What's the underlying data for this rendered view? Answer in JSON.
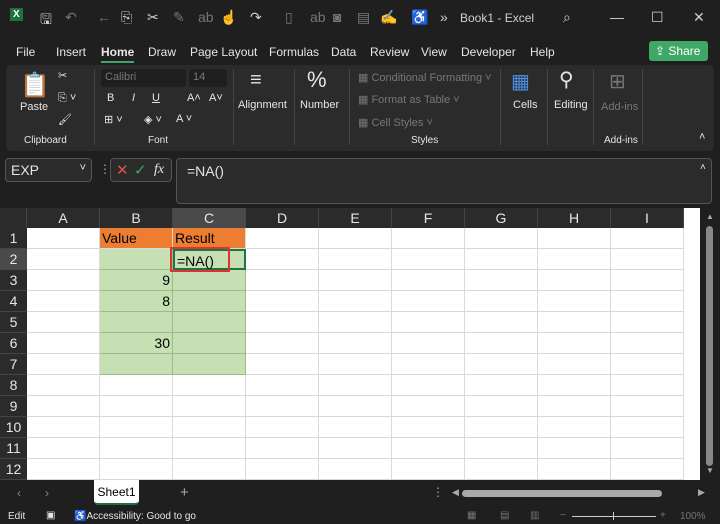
{
  "title": "Book1 - Excel",
  "menu": [
    "File",
    "Insert",
    "Home",
    "Draw",
    "Page Layout",
    "Formulas",
    "Data",
    "Review",
    "View",
    "Developer",
    "Help"
  ],
  "share_label": "Share",
  "ribbon": {
    "paste": "Paste",
    "clipboard": "Clipboard",
    "font_name": "Calibri",
    "font_size": "14",
    "font": "Font",
    "alignment": "Alignment",
    "number": "Number",
    "conditional": "Conditional Formatting",
    "format_table": "Format as Table",
    "cell_styles": "Cell Styles",
    "styles": "Styles",
    "cells": "Cells",
    "editing": "Editing",
    "addins": "Add-ins",
    "addins_group": "Add-ins"
  },
  "name_box": "EXP",
  "formula": "=NA()",
  "columns": [
    "A",
    "B",
    "C",
    "D",
    "E",
    "F",
    "G",
    "H",
    "I"
  ],
  "rows": [
    "1",
    "2",
    "3",
    "4",
    "5",
    "6",
    "7",
    "8",
    "9",
    "10",
    "11",
    "12"
  ],
  "cells": {
    "B1": "Value",
    "C1": "Result",
    "C2": "=NA()",
    "B3": "9",
    "B4": "8",
    "B6": "30"
  },
  "colors": {
    "header_fill": "#ed7d31",
    "data_fill": "#c6e0b4",
    "edit_border": "#e03131",
    "accent": "#3fa866"
  },
  "sheet_tab": "Sheet1",
  "status": {
    "mode": "Edit",
    "accessibility": "Accessibility: Good to go",
    "zoom": "100%"
  }
}
